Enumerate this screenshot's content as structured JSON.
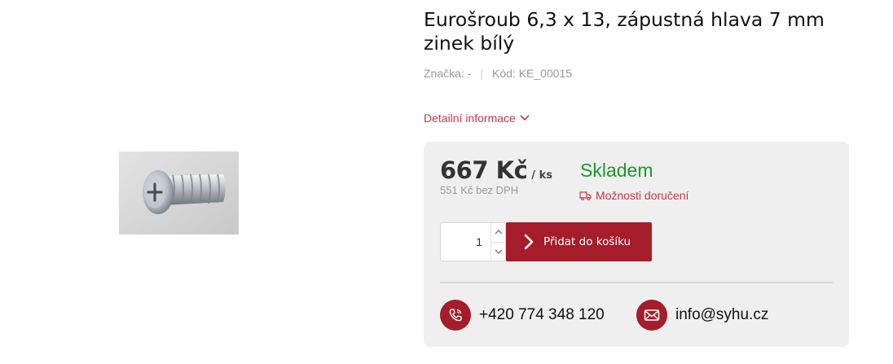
{
  "product": {
    "title": "Eurošroub 6,3 x 13, zápustná hlava 7 mm zinek bílý",
    "brand": "Značka: -",
    "separator": "|",
    "code": "Kód: KE_00015",
    "detail_link": "Detailní informace",
    "image_icon": "screw-photo"
  },
  "purchase": {
    "price": "667 Kč",
    "unit": "/ ks",
    "price_without_vat": "551 Kč bez DPH",
    "stock_status": "Skladem",
    "delivery_link": "Možnosti doručení",
    "quantity": "1",
    "add_to_cart": "Přidat do košíku"
  },
  "contacts": {
    "phone": "+420 774 348 120",
    "email": "info@syhu.cz"
  },
  "colors": {
    "accent": "#a51c2b",
    "link": "#c0394b",
    "stock": "#1d9a2a",
    "panel": "#efefef"
  }
}
